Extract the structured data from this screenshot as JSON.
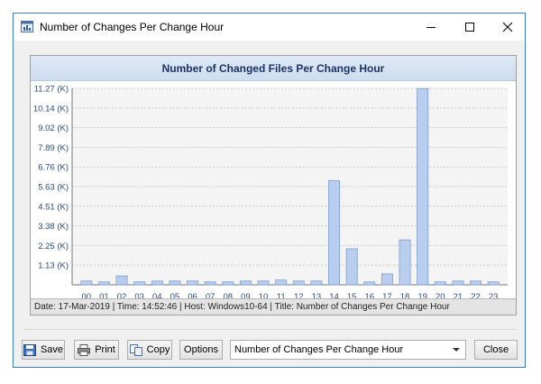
{
  "window": {
    "title": "Number of Changes Per Change Hour"
  },
  "chart_header": "Number of Changed Files Per Change Hour",
  "chart_data": {
    "type": "bar",
    "title": "Number of Changed Files Per Change Hour",
    "categories": [
      "00",
      "01",
      "02",
      "03",
      "04",
      "05",
      "06",
      "07",
      "08",
      "09",
      "10",
      "11",
      "12",
      "13",
      "14",
      "15",
      "16",
      "17",
      "18",
      "19",
      "20",
      "21",
      "22",
      "23"
    ],
    "values": [
      220,
      170,
      510,
      170,
      220,
      220,
      220,
      170,
      170,
      220,
      220,
      280,
      220,
      220,
      5980,
      2070,
      170,
      630,
      2580,
      11260,
      170,
      220,
      220,
      170
    ],
    "y_tick_labels": [
      "1.13 (K)",
      "2.25 (K)",
      "3.38 (K)",
      "4.51 (K)",
      "5.63 (K)",
      "6.76 (K)",
      "7.89 (K)",
      "9.02 (K)",
      "10.14 (K)",
      "11.27 (K)"
    ],
    "y_tick_values": [
      1127,
      2254,
      3381,
      4508,
      5635,
      6762,
      7889,
      9016,
      10143,
      11270
    ],
    "ylim": [
      0,
      11270
    ],
    "grid": true,
    "bar_color": "#b9cdee",
    "xlabel": "",
    "ylabel": ""
  },
  "statusbar": "Date: 17-Mar-2019 | Time: 14:52:46 | Host: Windows10-64 | Title: Number of Changes Per Change Hour",
  "buttons": {
    "save": "Save",
    "print": "Print",
    "copy": "Copy",
    "options": "Options",
    "close": "Close"
  },
  "chart_select": {
    "value": "Number of Changes Per Change Hour"
  },
  "icons": {
    "app": "chart-window-icon",
    "minimize": "minimize-icon",
    "maximize": "maximize-icon",
    "close": "close-icon",
    "save": "floppy-disk-icon",
    "print": "printer-icon",
    "copy": "copy-icon",
    "dropdown": "chevron-down-icon"
  }
}
